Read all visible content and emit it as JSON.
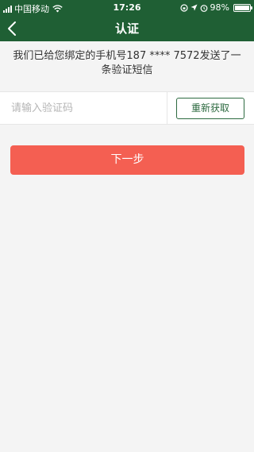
{
  "status_bar": {
    "carrier": "中国移动",
    "time": "17:26",
    "battery_percent": "98%",
    "battery_level": 0.98,
    "icons": [
      "signal-icon",
      "wifi-icon",
      "orientation-lock-icon",
      "location-icon",
      "alarm-icon",
      "battery-icon"
    ]
  },
  "nav": {
    "title": "认证",
    "back_icon": "chevron-left-icon"
  },
  "notice": {
    "text": "我们已给您绑定的手机号187 **** 7572发送了一条验证短信"
  },
  "verification": {
    "placeholder": "请输入验证码",
    "value": "",
    "resend_label": "重新获取"
  },
  "actions": {
    "next_label": "下一步"
  },
  "colors": {
    "header_bg": "#1f5f34",
    "page_bg": "#f4f4f4",
    "accent_green": "#2d6a40",
    "next_button_bg": "#f45f52"
  }
}
